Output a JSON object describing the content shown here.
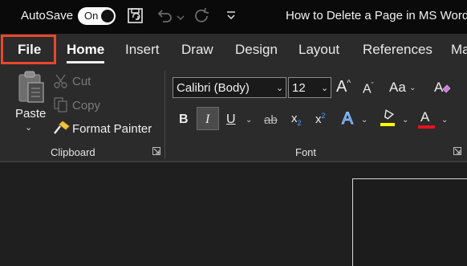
{
  "titlebar": {
    "autosave_label": "AutoSave",
    "autosave_state": "On",
    "document_title": "How to Delete a Page in MS Word"
  },
  "tabs": [
    {
      "label": "File",
      "highlighted": true
    },
    {
      "label": "Home",
      "active": true
    },
    {
      "label": "Insert"
    },
    {
      "label": "Draw"
    },
    {
      "label": "Design"
    },
    {
      "label": "Layout"
    },
    {
      "label": "References"
    },
    {
      "label": "Ma"
    }
  ],
  "clipboard": {
    "paste_label": "Paste",
    "cut_label": "Cut",
    "copy_label": "Copy",
    "format_painter_label": "Format Painter",
    "group_label": "Clipboard"
  },
  "font": {
    "font_name": "Calibri (Body)",
    "font_size": "12",
    "grow_font": "A",
    "shrink_font": "A",
    "change_case": "Aa",
    "bold": "B",
    "italic": "I",
    "underline": "U",
    "strikethrough": "ab",
    "subscript_base": "x",
    "subscript_mark": "2",
    "superscript_base": "x",
    "superscript_mark": "2",
    "text_effects": "A",
    "font_color": "A",
    "group_label": "Font"
  },
  "colors": {
    "highlight_accent": "#e8472d",
    "text_highlight_color": "#ffff00",
    "font_color": "#e81123",
    "text_effects_color": "#2e7fd6"
  },
  "icons": [
    "save-sync-icon",
    "undo-icon",
    "redo-icon",
    "customize-quick-access-icon",
    "paste-icon",
    "cut-icon",
    "copy-icon",
    "format-painter-icon",
    "clear-formatting-icon",
    "dialog-launcher-icon"
  ]
}
